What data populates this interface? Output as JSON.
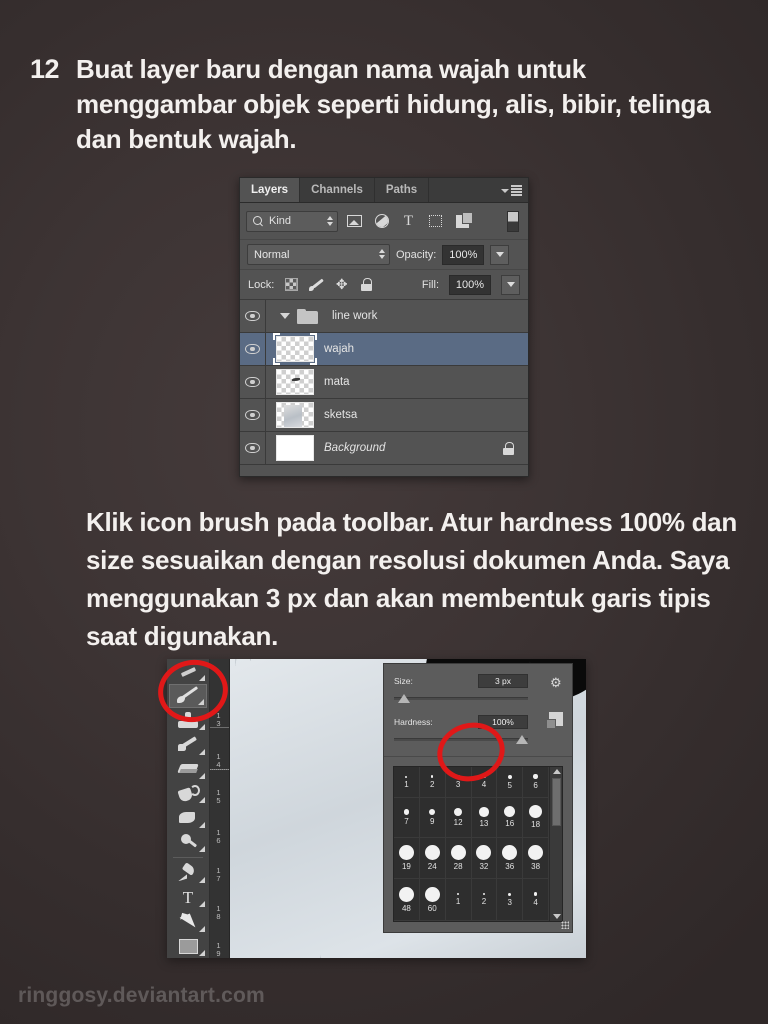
{
  "page": {
    "background_color": "#3d3434",
    "watermark": "ringgosy.deviantart.com"
  },
  "steps": [
    {
      "number": "12",
      "text": "Buat layer baru dengan nama wajah untuk menggambar objek seperti hidung, alis, bibir, telinga dan bentuk wajah."
    }
  ],
  "paragraph2": "Klik icon brush pada toolbar. Atur hardness 100% dan size sesuaikan dengan resolusi dokumen Anda. Saya menggunakan 3 px dan akan membentuk garis tipis saat digunakan.",
  "layers_panel": {
    "tabs": [
      {
        "label": "Layers",
        "active": true
      },
      {
        "label": "Channels",
        "active": false
      },
      {
        "label": "Paths",
        "active": false
      }
    ],
    "filter": {
      "kind_label": "Kind",
      "icons": [
        "image-filter-icon",
        "adjustment-filter-icon",
        "type-filter-icon",
        "shape-filter-icon",
        "smart-object-filter-icon"
      ],
      "toggle_name": "filter-toggle-switch"
    },
    "blend_mode": "Normal",
    "opacity_label": "Opacity:",
    "opacity_value": "100%",
    "lock_label": "Lock:",
    "lock_icons": [
      "lock-transparent-pixels-icon",
      "lock-image-pixels-icon",
      "lock-position-icon",
      "lock-all-icon"
    ],
    "fill_label": "Fill:",
    "fill_value": "100%",
    "layers": [
      {
        "name": "line work",
        "type": "group",
        "visible": true,
        "selected": false,
        "locked": false,
        "italic": false
      },
      {
        "name": "wajah",
        "type": "layer",
        "visible": true,
        "selected": true,
        "locked": false,
        "italic": false
      },
      {
        "name": "mata",
        "type": "layer",
        "visible": true,
        "selected": false,
        "locked": false,
        "italic": false
      },
      {
        "name": "sketsa",
        "type": "layer",
        "visible": true,
        "selected": false,
        "locked": false,
        "italic": false
      },
      {
        "name": "Background",
        "type": "layer",
        "visible": true,
        "selected": false,
        "locked": true,
        "italic": true
      }
    ]
  },
  "photoshop_screenshot": {
    "toolbar_tools": [
      {
        "name": "partial-tool-above",
        "active": false
      },
      {
        "name": "brush-tool",
        "active": true
      },
      {
        "name": "clone-stamp-tool",
        "active": false
      },
      {
        "name": "history-brush-tool",
        "active": false
      },
      {
        "name": "eraser-tool",
        "active": false
      },
      {
        "name": "paint-bucket-tool",
        "active": false
      },
      {
        "name": "gradient-tool",
        "active": false
      },
      {
        "name": "blur-tool",
        "active": false
      },
      {
        "name": "pen-tool",
        "active": false
      },
      {
        "name": "type-tool",
        "active": false
      },
      {
        "name": "path-selection-tool",
        "active": false
      },
      {
        "name": "rectangle-tool",
        "active": false
      }
    ],
    "ruler_ticks": [
      "1 3",
      "1 4",
      "1 5",
      "1 6",
      "1 7",
      "1 8",
      "1 9"
    ],
    "brush_popup": {
      "size_label": "Size:",
      "size_value": "3 px",
      "hardness_label": "Hardness:",
      "hardness_value": "100%",
      "gear_icon": "gear-icon",
      "new_preset_icon": "new-brush-preset-icon",
      "resize_grip": "resize-grip-icon",
      "presets": [
        {
          "label": "1",
          "dot": 2
        },
        {
          "label": "2",
          "dot": 2.5
        },
        {
          "label": "3",
          "dot": 3
        },
        {
          "label": "4",
          "dot": 3.5
        },
        {
          "label": "5",
          "dot": 4
        },
        {
          "label": "6",
          "dot": 4.5
        },
        {
          "label": "7",
          "dot": 5.5
        },
        {
          "label": "9",
          "dot": 6.5
        },
        {
          "label": "12",
          "dot": 8.5
        },
        {
          "label": "13",
          "dot": 9.5
        },
        {
          "label": "16",
          "dot": 11
        },
        {
          "label": "18",
          "dot": 13
        },
        {
          "label": "19",
          "dot": 15
        },
        {
          "label": "24",
          "dot": 15
        },
        {
          "label": "28",
          "dot": 15
        },
        {
          "label": "32",
          "dot": 15
        },
        {
          "label": "36",
          "dot": 15
        },
        {
          "label": "38",
          "dot": 15
        },
        {
          "label": "48",
          "dot": 15
        },
        {
          "label": "60",
          "dot": 15
        },
        {
          "label": "1",
          "dot": 2
        },
        {
          "label": "2",
          "dot": 2.5
        },
        {
          "label": "3",
          "dot": 3
        },
        {
          "label": "4",
          "dot": 3.5
        }
      ]
    },
    "annotations": [
      {
        "name": "brush-tool-highlight",
        "color": "#e01818",
        "shape": "ellipse"
      },
      {
        "name": "hardness-value-highlight",
        "color": "#e01818",
        "shape": "ellipse"
      }
    ]
  }
}
